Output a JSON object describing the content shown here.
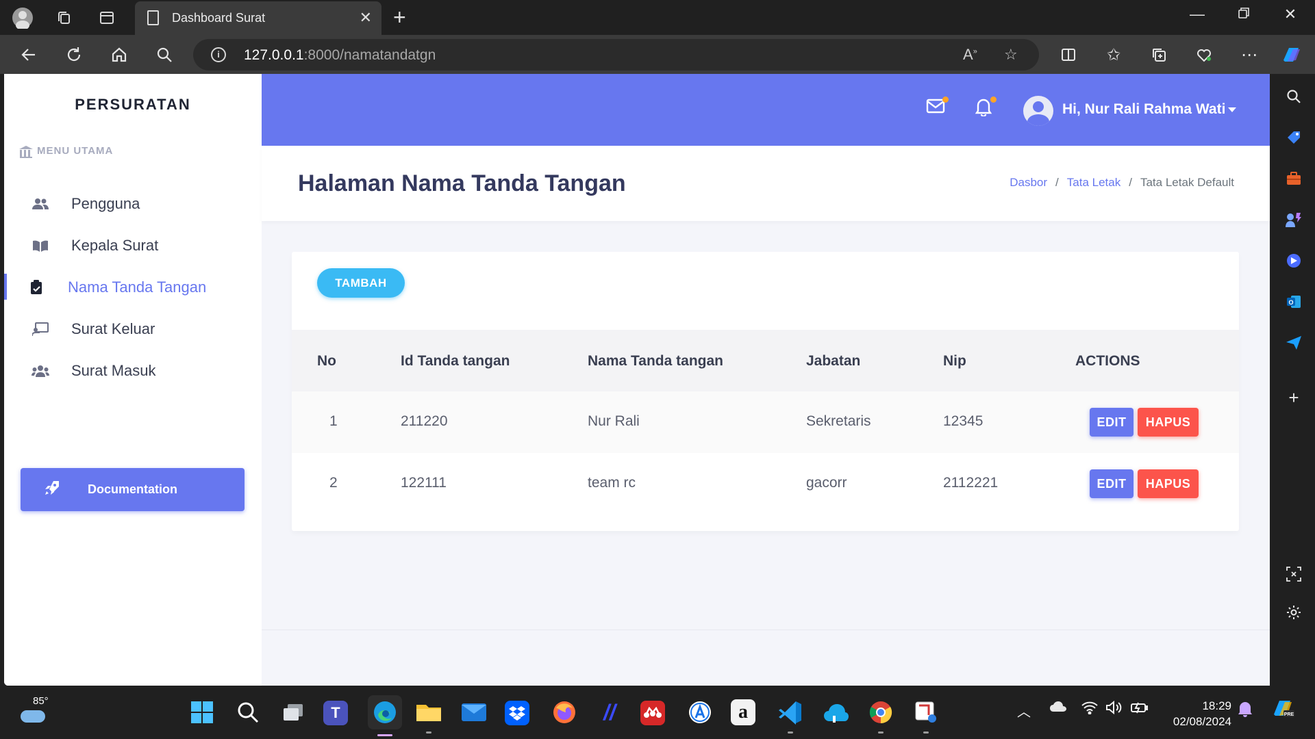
{
  "browser": {
    "tab_title": "Dashboard Surat",
    "url_host": "127.0.0.1",
    "url_rest": ":8000/namatandatgn"
  },
  "sidebar": {
    "brand": "PERSURATAN",
    "menu_title": "MENU UTAMA",
    "items": [
      {
        "label": "Pengguna",
        "icon": "users-icon"
      },
      {
        "label": "Kepala Surat",
        "icon": "book-icon"
      },
      {
        "label": "Nama Tanda Tangan",
        "icon": "clipboard-check-icon",
        "active": true
      },
      {
        "label": "Surat Keluar",
        "icon": "chalkboard-icon"
      },
      {
        "label": "Surat Masuk",
        "icon": "group-icon"
      }
    ],
    "doc_button": "Documentation"
  },
  "topnav": {
    "greeting": "Hi, Nur Rali Rahma Wati"
  },
  "header": {
    "title": "Halaman Nama Tanda Tangan",
    "breadcrumb": [
      "Dasbor",
      "Tata Letak",
      "Tata Letak Default"
    ]
  },
  "table": {
    "add_button": "TAMBAH",
    "columns": [
      "No",
      "Id Tanda tangan",
      "Nama Tanda tangan",
      "Jabatan",
      "Nip",
      "ACTIONS"
    ],
    "rows": [
      {
        "no": "1",
        "id": "211220",
        "nama": "Nur Rali",
        "jabatan": "Sekretaris",
        "nip": "12345"
      },
      {
        "no": "2",
        "id": "122111",
        "nama": "team rc",
        "jabatan": "gacorr",
        "nip": "2112221"
      }
    ],
    "edit_label": "EDIT",
    "delete_label": "HAPUS"
  },
  "taskbar": {
    "temperature": "85°",
    "time": "18:29",
    "date": "02/08/2024"
  },
  "colors": {
    "primary": "#6777ef",
    "info": "#3abaf4",
    "danger": "#fc544b",
    "warning": "#ffa426"
  }
}
